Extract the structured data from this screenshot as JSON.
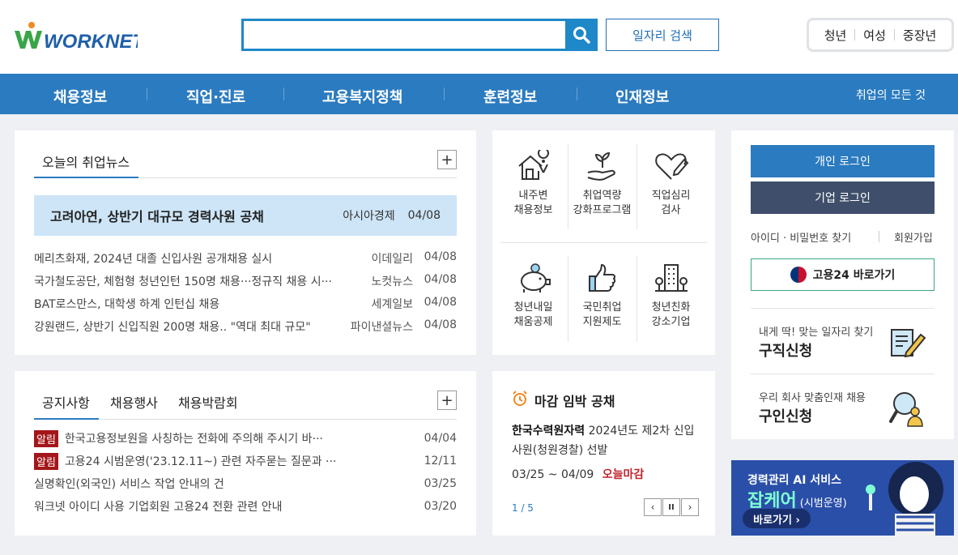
{
  "header": {
    "logo_text": "WORKNET",
    "search_placeholder": "",
    "search_value": "",
    "job_search_label": "일자리 검색",
    "segments": [
      "청년",
      "여성",
      "중장년"
    ]
  },
  "nav": {
    "items": [
      "채용정보",
      "직업·진로",
      "고용복지정책",
      "훈련정보",
      "인재정보"
    ],
    "right_label": "취업의 모든 것"
  },
  "news": {
    "tab_label": "오늘의 취업뉴스",
    "more_label": "+",
    "headline": {
      "title": "고려아연, 상반기 대규모 경력사원 공채",
      "source": "아시아경제",
      "date": "04/08"
    },
    "items": [
      {
        "title": "메리츠화재, 2024년 대졸 신입사원 공개채용 실시",
        "source": "이데일리",
        "date": "04/08"
      },
      {
        "title": "국가철도공단, 체험형 청년인턴 150명 채용···정규직 채용 시···",
        "source": "노컷뉴스",
        "date": "04/08"
      },
      {
        "title": "BAT로스만스, 대학생 하계 인턴십 채용",
        "source": "세계일보",
        "date": "04/08"
      },
      {
        "title": "강원랜드, 상반기 신입직원 200명 채용.. \"역대 최대 규모\"",
        "source": "파이낸셜뉴스",
        "date": "04/08"
      }
    ]
  },
  "quick_icons": [
    {
      "line1": "내주변",
      "line2": "채용정보",
      "icon": "house-location-icon"
    },
    {
      "line1": "취업역량",
      "line2": "강화프로그램",
      "icon": "hand-sprout-icon"
    },
    {
      "line1": "직업심리",
      "line2": "검사",
      "icon": "heart-pencil-icon"
    },
    {
      "line1": "청년내일",
      "line2": "채움공제",
      "icon": "piggy-bank-icon"
    },
    {
      "line1": "국민취업",
      "line2": "지원제도",
      "icon": "thumbs-up-icon"
    },
    {
      "line1": "청년친화",
      "line2": "강소기업",
      "icon": "building-icon"
    }
  ],
  "login": {
    "personal_label": "개인 로그인",
    "company_label": "기업 로그인",
    "find_label": "아이디 · 비밀번호 찾기",
    "join_label": "회원가입",
    "gov24_label": "고용24 바로가기",
    "job_seek_sub": "내게 딱! 맞는 일자리 찾기",
    "job_seek_main": "구직신청",
    "recruit_sub": "우리 회사 맞춤인재 채용",
    "recruit_main": "구인신청"
  },
  "notice": {
    "tabs": [
      "공지사항",
      "채용행사",
      "채용박람회"
    ],
    "more_label": "+",
    "items": [
      {
        "badge": "알림",
        "title": "한국고용정보원을 사칭하는 전화에 주의해 주시기 바···",
        "date": "04/04"
      },
      {
        "badge": "알림",
        "title": "고용24 시범운영('23.12.11~) 관련 자주묻는 질문과 ···",
        "date": "12/11"
      },
      {
        "badge": "",
        "title": "실명확인(외국인) 서비스 작업 안내의 건",
        "date": "03/25"
      },
      {
        "badge": "",
        "title": "워크넷 아이디 사용 기업회원 고용24 전환 관련 안내",
        "date": "03/20"
      }
    ]
  },
  "deadline": {
    "title": "마감 임박 공채",
    "company": "한국수력원자력",
    "desc": "2024년도 제2차 신입사원(청원경찰) 선발",
    "period": "03/25 ~ 04/09",
    "status": "오늘마감",
    "page": "1 / 5",
    "prev": "‹",
    "pause": "II",
    "next": "›"
  },
  "banner": {
    "line1": "경력관리 AI 서비스",
    "line2": "잡케어",
    "line2_sub": "(시범운영)",
    "button": "바로가기 ›"
  },
  "colors": {
    "primary": "#2b7bc0",
    "search_border": "#1e88c9",
    "company_login": "#3f4f6b",
    "alert_badge": "#a4161a",
    "banner_bg": "#2a4fa8"
  }
}
